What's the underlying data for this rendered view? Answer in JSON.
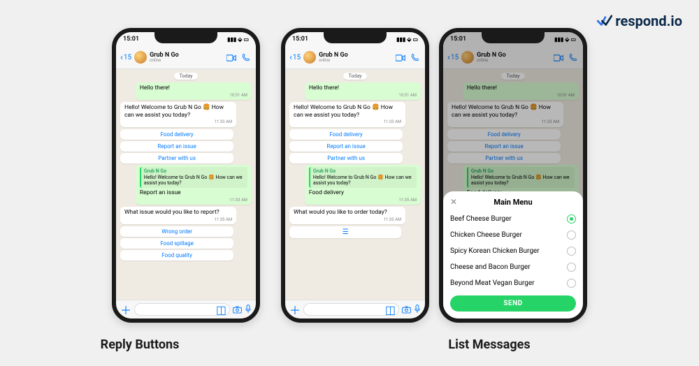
{
  "brand": "respond.io",
  "captions": {
    "reply": "Reply Buttons",
    "list": "List Messages"
  },
  "status": {
    "time": "15:01"
  },
  "header": {
    "back_count": "15",
    "name": "Grub N Go",
    "status": "online"
  },
  "chat": {
    "date": "Today",
    "hello": "Hello there!",
    "hello_time": "10:51 AM",
    "welcome": "Hello! Welcome to Grub N Go 🍔 How can we assist you today?",
    "welcome_time": "11:33 AM",
    "btn1": "Food delivery",
    "btn2": "Report an issue",
    "btn3": "Partner with us",
    "quote_name": "Grub N Go",
    "quote_text": "Hello! Welcome to Grub N Go 🍔 How can we assist you today?"
  },
  "phone1": {
    "reply_choice": "Report an issue",
    "reply_time": "11:33 AM",
    "followup": "What issue would you like to report?",
    "followup_time": "11:35 AM",
    "b1": "Wrong order",
    "b2": "Food spillage",
    "b3": "Food quality"
  },
  "phone2": {
    "reply_choice": "Food delivery",
    "reply_time": "11:35 AM",
    "followup": "What would you like to order today?",
    "followup_time": "11:35 AM"
  },
  "sheet": {
    "title": "Main Menu",
    "options": [
      "Beef Cheese Burger",
      "Chicken Cheese Burger",
      "Spicy Korean Chicken Burger",
      "Cheese and Bacon Burger",
      "Beyond Meat Vegan Burger"
    ],
    "selected_index": 0,
    "send": "SEND"
  }
}
